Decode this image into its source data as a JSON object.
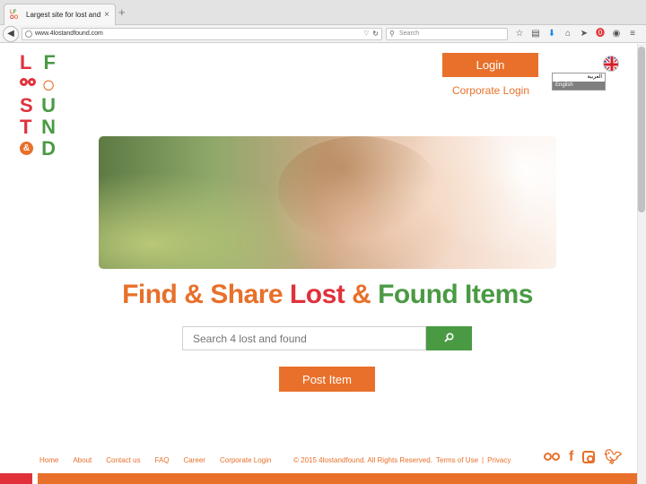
{
  "browser": {
    "tab_title": "Largest site for lost and fou…",
    "tab_close": "×",
    "new_tab": "+",
    "url": "www.4lostandfound.com",
    "search_placeholder": "Search"
  },
  "logo": {
    "letters": [
      "L",
      "F",
      "U",
      "S",
      "U",
      "N",
      "T",
      "N",
      "D"
    ],
    "amp": "&"
  },
  "header": {
    "login_label": "Login",
    "corporate_login_label": "Corporate Login",
    "languages": [
      "العربية",
      "English"
    ],
    "selected_language": "English"
  },
  "hero": {
    "headline_part1": "Find & Share ",
    "headline_part2": "Lost",
    "headline_part3": " & ",
    "headline_part4": "Found Items"
  },
  "search": {
    "placeholder": "Search 4 lost and found"
  },
  "post_item_label": "Post Item",
  "footer": {
    "links": [
      "Home",
      "About",
      "Contact us",
      "FAQ",
      "Career",
      "Corporate Login"
    ],
    "copyright": "© 2015 4lostandfound. All Rights Reserved.",
    "terms": "Terms of Use",
    "separator": "|",
    "privacy": "Privacy"
  },
  "colors": {
    "orange": "#e8702a",
    "red": "#e0313b",
    "green": "#4a9a44"
  },
  "icons": [
    "back-arrow-icon",
    "globe-icon",
    "reload-icon",
    "search-icon",
    "star-icon",
    "clipboard-icon",
    "download-icon",
    "home-icon",
    "send-icon",
    "pinterest-icon",
    "chat-icon",
    "menu-icon",
    "uk-flag-icon",
    "binoculars-icon",
    "facebook-icon",
    "instagram-icon",
    "twitter-icon"
  ]
}
